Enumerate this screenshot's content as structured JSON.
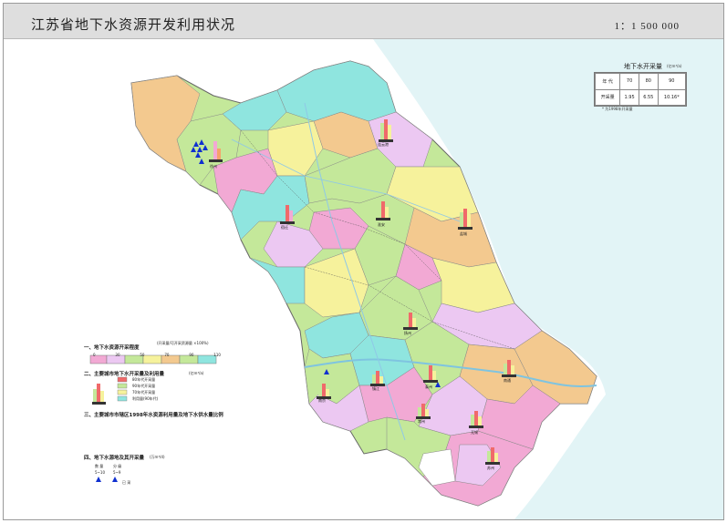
{
  "header": {
    "title": "江苏省地下水资源开发利用状况",
    "scale": "1：1 500 000"
  },
  "inset_table": {
    "title": "地下水开采量",
    "unit": "(亿m³/a)",
    "row1": [
      "年 代",
      "70",
      "80",
      "90"
    ],
    "row2": [
      "开采量",
      "1.95",
      "6.55",
      "10.16*"
    ],
    "note": "* 为1998年开采量"
  },
  "legend": {
    "s1_title": "一、地下水资源开采程度",
    "s1_sub": "(开采量/可开采资源量 ×100%)",
    "s1_ticks": [
      "0",
      "30",
      "50",
      "70",
      "90",
      "110"
    ],
    "s2_title": "二、主要城市地下水开采量及利用量",
    "s2_unit": "(亿m³/a)",
    "s2_items": [
      "80年代开采量",
      "90年代开采量",
      "70年代开采量",
      "利用量(90年代)"
    ],
    "s3_title": "三、主要城市市辖区1998年水资源利用量及地下水供水量比例",
    "s4_title": "四、地下水源地及其开采量",
    "s4_unit": "(万m³/d)",
    "s4_cols": [
      "数 量",
      "分 级"
    ],
    "s4_rows": [
      "5~10",
      "5~9",
      "已 采"
    ]
  },
  "colors": {
    "pink": "#f2a9d4",
    "light_pink": "#ecc8f2",
    "green": "#c4e89a",
    "yellow": "#f6f29c",
    "orange": "#f3c98f",
    "cyan": "#8fe5df",
    "sea": "#e2f4f6",
    "boundary": "#666666"
  },
  "map": {
    "cities": [
      "徐州",
      "连云港",
      "宿迁",
      "淮安",
      "盐城",
      "扬州",
      "泰州",
      "南通",
      "南京",
      "镇江",
      "常州",
      "无锡",
      "苏州"
    ]
  }
}
